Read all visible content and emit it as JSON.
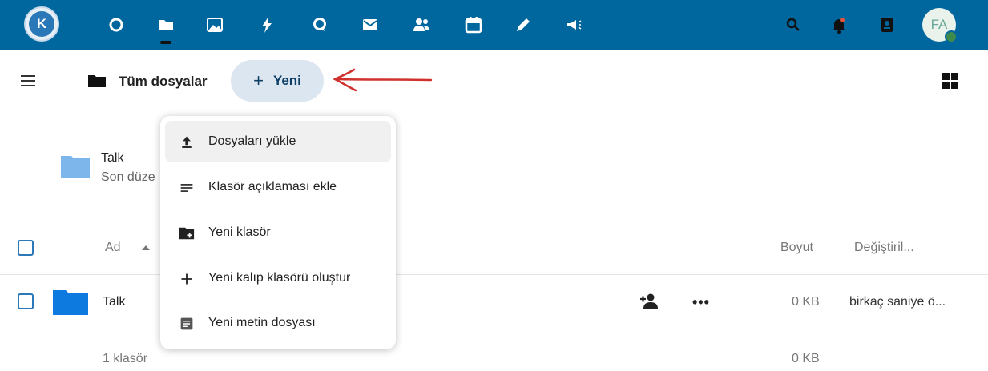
{
  "topbar": {
    "logo_letter": "K",
    "avatar_initials": "FA",
    "apps": [
      {
        "name": "dashboard-icon"
      },
      {
        "name": "files-icon"
      },
      {
        "name": "photos-icon"
      },
      {
        "name": "activity-icon"
      },
      {
        "name": "talk-icon"
      },
      {
        "name": "mail-icon"
      },
      {
        "name": "contacts-icon"
      },
      {
        "name": "calendar-icon"
      },
      {
        "name": "notes-icon"
      },
      {
        "name": "announcements-icon"
      }
    ],
    "right_icons": [
      "search-icon",
      "notifications-icon",
      "contacts-menu-icon"
    ]
  },
  "header": {
    "breadcrumb": "Tüm dosyalar",
    "new_button_label": "Yeni",
    "new_button_plus": "+"
  },
  "folder_description": {
    "name": "Talk",
    "subtitle": "Son düze"
  },
  "table": {
    "columns": {
      "name": "Ad",
      "size": "Boyut",
      "modified": "Değiştiril..."
    },
    "rows": [
      {
        "name": "Talk",
        "size": "0 KB",
        "modified": "birkaç saniye ö..."
      }
    ],
    "footer": {
      "summary": "1 klasör",
      "size": "0 KB"
    }
  },
  "new_menu": {
    "items": [
      {
        "label": "Dosyaları yükle",
        "icon": "upload-icon"
      },
      {
        "label": "Klasör açıklaması ekle",
        "icon": "text-lines-icon"
      },
      {
        "label": "Yeni klasör",
        "icon": "new-folder-icon"
      },
      {
        "label": "Yeni kalıp klasörü oluştur",
        "icon": "plus-icon"
      },
      {
        "label": "Yeni metin dosyası",
        "icon": "text-file-icon"
      }
    ]
  },
  "colors": {
    "topbar": "#00679e",
    "accent": "#2a78b8",
    "annotation_arrow": "#d0312d"
  }
}
